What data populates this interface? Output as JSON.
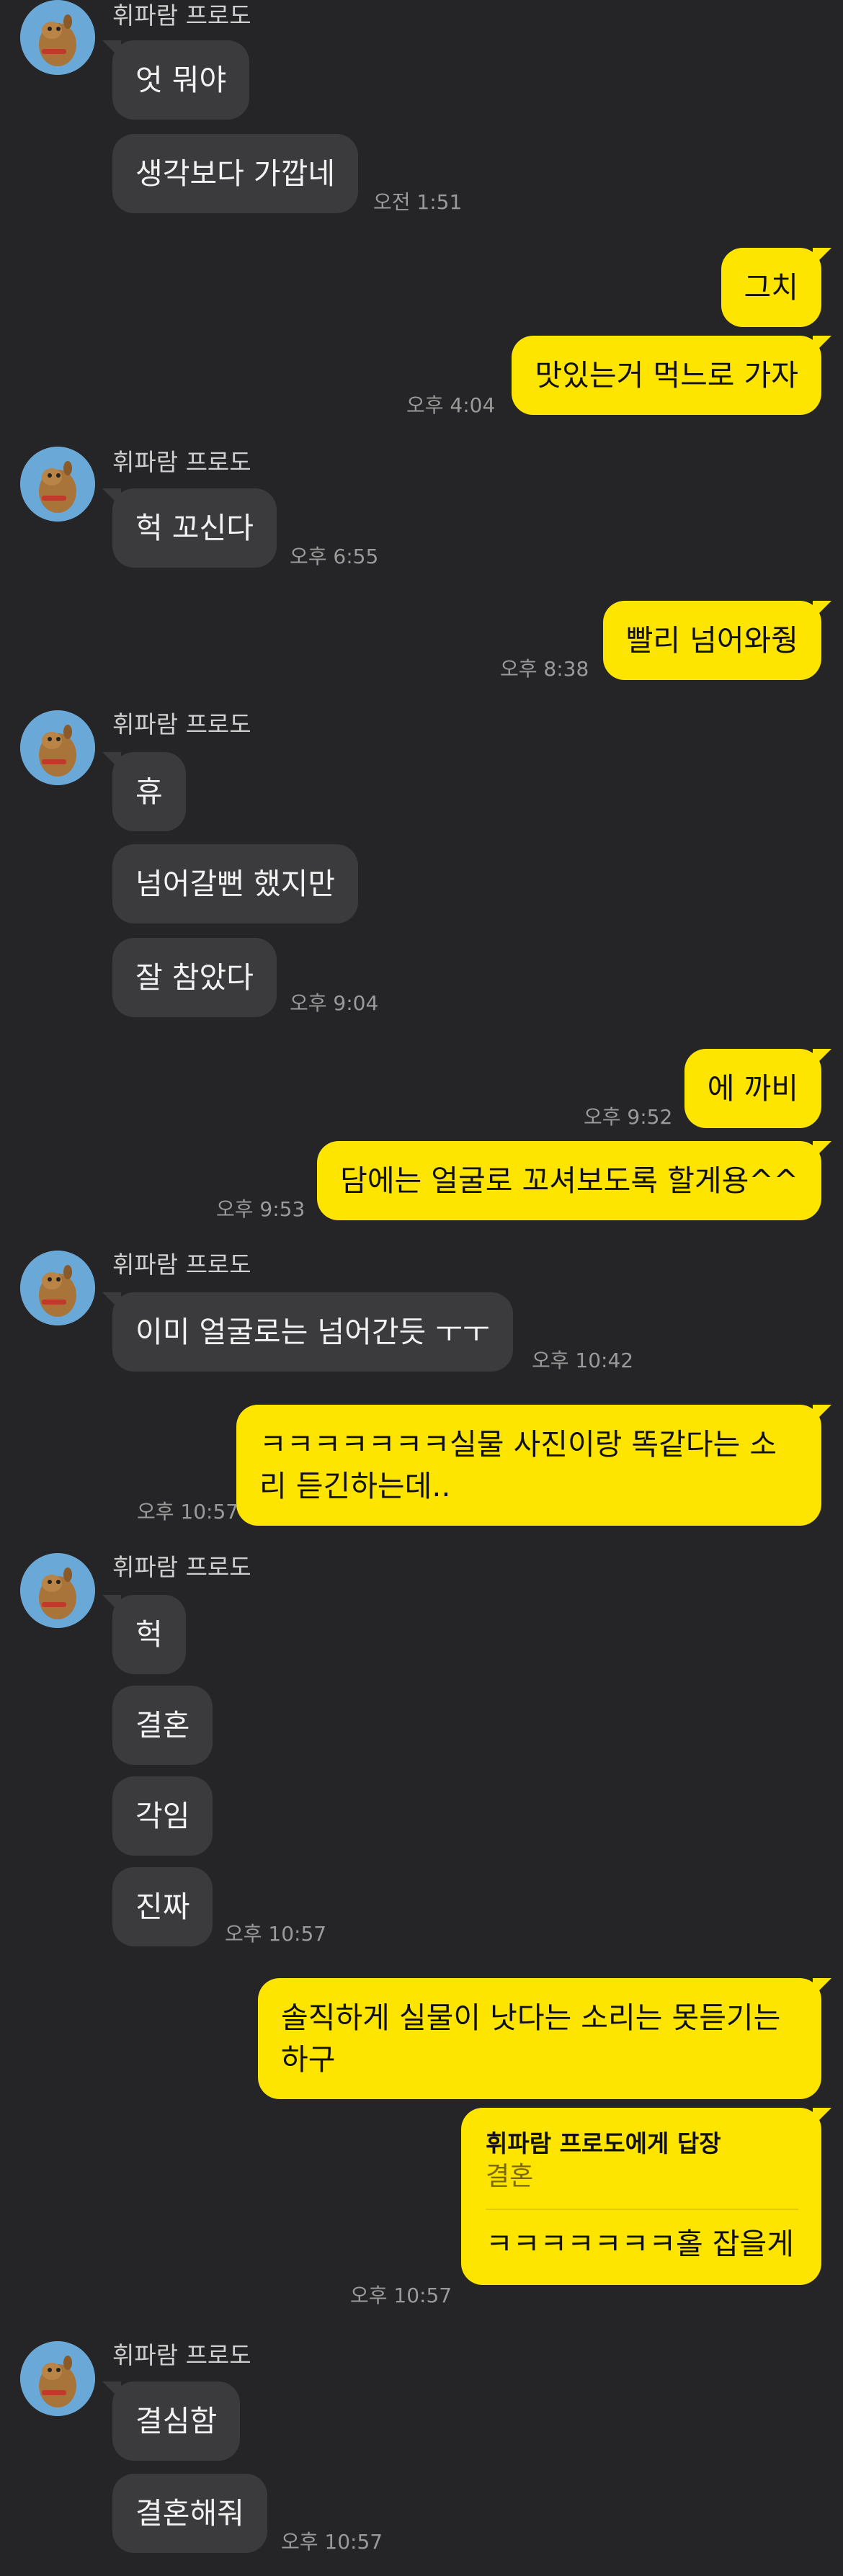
{
  "sender": "휘파람 프로도",
  "messages": {
    "m1": "엇 뭐야",
    "m2": "생각보다 가깝네",
    "t1": "오전 1:51",
    "m3": "그치",
    "m4": "맛있는거 먹느로 가자",
    "t2": "오후 4:04",
    "m5": "헉 꼬신다",
    "t3": "오후 6:55",
    "m6": "빨리 넘어와줭",
    "t4": "오후 8:38",
    "m7": "휴",
    "m8": "넘어갈뻔 했지만",
    "m9": "잘 참았다",
    "t5": "오후 9:04",
    "m10": "에 까비",
    "t6": "오후 9:52",
    "m11": "담에는 얼굴로 꼬셔보도록 할게용^^",
    "t7": "오후 9:53",
    "m12": "이미 얼굴로는 넘어간듯 ㅜㅜ",
    "t8": "오후 10:42",
    "m13": "ㅋㅋㅋㅋㅋㅋㅋ실물 사진이랑 똑같다는 소리 듣긴하는데..",
    "t9": "오후 10:57",
    "m14": "헉",
    "m15": "결혼",
    "m16": "각임",
    "m17": "진짜",
    "t10": "오후 10:57",
    "m18": "솔직하게 실물이 낫다는 소리는 못듣기는 하구",
    "reply_header": "휘파람 프로도에게 답장",
    "reply_quote": "결혼",
    "m19": "ㅋㅋㅋㅋㅋㅋㅋ홀 잡을게",
    "t11": "오후 10:57",
    "m20": "결심함",
    "m21": "결혼해줘",
    "t12": "오후 10:57"
  }
}
